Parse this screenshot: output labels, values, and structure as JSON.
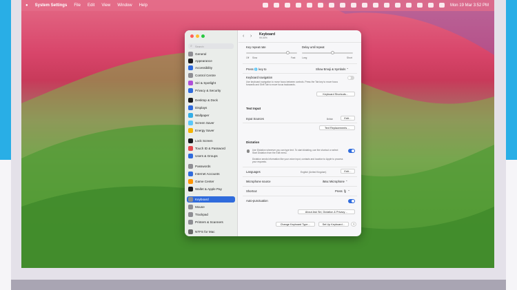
{
  "menubar": {
    "apple_icon": "apple-icon",
    "menus": [
      "System Settings",
      "File",
      "Edit",
      "View",
      "Window",
      "Help"
    ],
    "clock": "Mon 19 Mar 3:52 PM"
  },
  "window": {
    "title": "Keyboard",
    "subtitle": "99.00%",
    "search_placeholder": "Search"
  },
  "sidebar": {
    "items": [
      {
        "label": "General",
        "icon": "gear-icon",
        "color": "#8e8e93"
      },
      {
        "label": "Appearance",
        "icon": "appearance-icon",
        "color": "#1c1c1e"
      },
      {
        "label": "Accessibility",
        "icon": "accessibility-icon",
        "color": "#2f6bdc"
      },
      {
        "label": "Control Centre",
        "icon": "control-centre-icon",
        "color": "#8e8e93"
      },
      {
        "label": "Siri & Spotlight",
        "icon": "siri-icon",
        "color": "#b04fd8"
      },
      {
        "label": "Privacy & Security",
        "icon": "hand-icon",
        "color": "#2f6bdc"
      },
      {
        "label": "Desktop & Dock",
        "icon": "dock-icon",
        "color": "#1c1c1e"
      },
      {
        "label": "Displays",
        "icon": "display-icon",
        "color": "#2f6bdc"
      },
      {
        "label": "Wallpaper",
        "icon": "wallpaper-icon",
        "color": "#32ade6"
      },
      {
        "label": "Screen Saver",
        "icon": "screen-saver-icon",
        "color": "#5ac8fa"
      },
      {
        "label": "Energy Saver",
        "icon": "battery-icon",
        "color": "#f5b400"
      },
      {
        "label": "Lock Screen",
        "icon": "lock-icon",
        "color": "#1c1c1e"
      },
      {
        "label": "Touch ID & Password",
        "icon": "fingerprint-icon",
        "color": "#e5484d"
      },
      {
        "label": "Users & Groups",
        "icon": "users-icon",
        "color": "#2f6bdc"
      },
      {
        "label": "Passwords",
        "icon": "key-icon",
        "color": "#8e8e93"
      },
      {
        "label": "Internet Accounts",
        "icon": "at-icon",
        "color": "#2f6bdc"
      },
      {
        "label": "Game Center",
        "icon": "game-center-icon",
        "color": "#ff9500"
      },
      {
        "label": "Wallet & Apple Pay",
        "icon": "wallet-icon",
        "color": "#1c1c1e"
      },
      {
        "label": "Keyboard",
        "icon": "keyboard-icon",
        "color": "#8e8e93"
      },
      {
        "label": "Mouse",
        "icon": "mouse-icon",
        "color": "#8e8e93"
      },
      {
        "label": "Trackpad",
        "icon": "trackpad-icon",
        "color": "#8e8e93"
      },
      {
        "label": "Printers & Scanners",
        "icon": "printer-icon",
        "color": "#8e8e93"
      },
      {
        "label": "NTFS for Mac",
        "icon": "ntfs-icon",
        "color": "#6a6a6a"
      }
    ],
    "selected": "Keyboard"
  },
  "content": {
    "key_repeat_rate": {
      "label": "Key repeat rate",
      "left": "Off",
      "slow": "Slow",
      "fast": "Fast",
      "level": 0.82
    },
    "delay_until_repeat": {
      "label": "Delay until repeat",
      "long": "Long",
      "short": "Short",
      "level": 0.6
    },
    "press_key": {
      "label_pre": "Press",
      "label_post": "key to",
      "globe_icon": "globe-icon",
      "value": "Show Emoji & Symbols"
    },
    "keyboard_navigation": {
      "title": "Keyboard navigation",
      "desc": "Use keyboard navigation to move focus between controls. Press the Tab key to move focus forwards and Shift Tab to move focus backwards.",
      "enabled": false
    },
    "keyboard_shortcuts_button": "Keyboard Shortcuts…",
    "text_input": {
      "section": "Text Input",
      "input_sources": "Input Sources",
      "input_sources_value": "British",
      "edit": "Edit…",
      "text_replacements": "Text Replacements…"
    },
    "dictation": {
      "section": "Dictation",
      "desc1": "Use Dictation wherever you can type text. To start dictating, use the shortcut or select Start Dictation from the Edit menu.",
      "desc2": "Dictation sends information like your voice input, contacts and location to Apple to process your requests.",
      "enabled": true,
      "languages_label": "Languages",
      "languages_value": "English (United Kingdom)",
      "languages_edit": "Edit…",
      "microphone_label": "Microphone source",
      "microphone_value": "iMac Microphone",
      "shortcut_label": "Shortcut",
      "shortcut_value": "Press",
      "auto_punct_label": "Auto-punctuation",
      "auto_punct_enabled": true,
      "about_button": "About Ask Siri, Dictation & Privacy…"
    },
    "footer": {
      "change_type": "Change Keyboard Type…",
      "set_up": "Set Up Keyboard…",
      "help": "?"
    }
  }
}
